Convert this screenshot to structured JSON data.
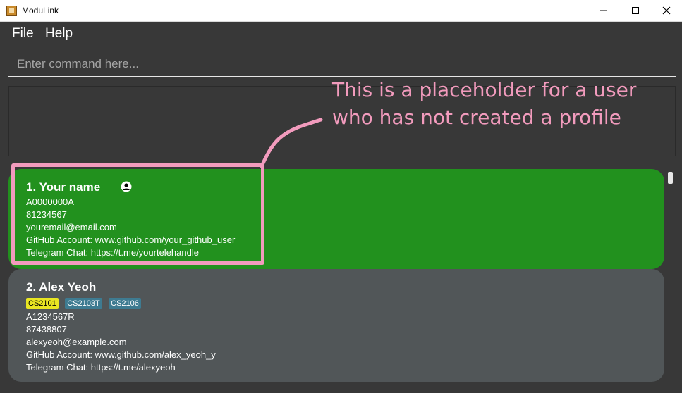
{
  "window": {
    "title": "ModuLink",
    "minimize_icon": "minimize-icon",
    "maximize_icon": "maximize-icon",
    "close_icon": "close-icon"
  },
  "menu": {
    "items": [
      "File",
      "Help"
    ]
  },
  "command": {
    "placeholder": "Enter command here..."
  },
  "result": {
    "text": ""
  },
  "persons": [
    {
      "index_name": "1. Your name",
      "icon": "user-icon",
      "tags": [],
      "id": "A0000000A",
      "phone": "81234567",
      "email": "youremail@email.com",
      "github": "GitHub Account: www.github.com/your_github_user",
      "telegram": "Telegram Chat: https://t.me/yourtelehandle",
      "card_color": "#22911e"
    },
    {
      "index_name": "2. Alex Yeoh",
      "tags": [
        {
          "label": "CS2101",
          "color": "#e9e622"
        },
        {
          "label": "CS2103T",
          "color": "#3e7b91"
        },
        {
          "label": "CS2106",
          "color": "#3e7b91"
        }
      ],
      "id": "A1234567R",
      "phone": "87438807",
      "email": "alexyeoh@example.com",
      "github": "GitHub Account: www.github.com/alex_yeoh_y",
      "telegram": "Telegram Chat: https://t.me/alexyeoh",
      "card_color": "#515658"
    }
  ],
  "annotation": {
    "line1": "This is a placeholder for a user",
    "line2": "who has not created a profile",
    "color": "#f29bbd"
  }
}
